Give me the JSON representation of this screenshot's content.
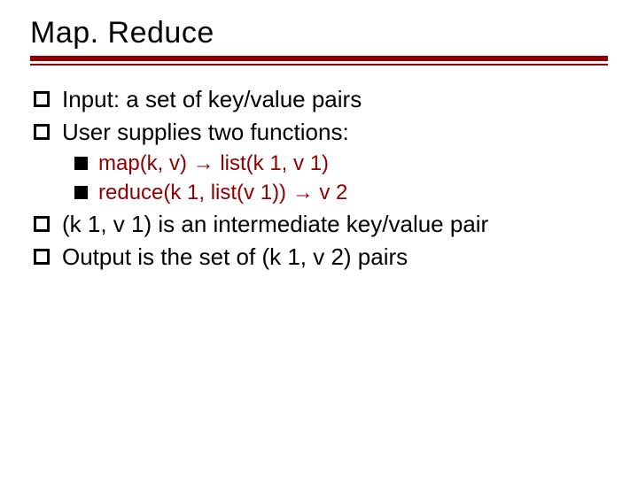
{
  "title": "Map. Reduce",
  "bullets": [
    {
      "level": 1,
      "text": "Input: a set of key/value pairs"
    },
    {
      "level": 1,
      "text": "User supplies two functions:"
    },
    {
      "level": 2,
      "text": "map(k, v) → list(k 1, v 1)"
    },
    {
      "level": 2,
      "text": "reduce(k 1, list(v 1)) → v 2"
    },
    {
      "level": 1,
      "text": "(k 1, v 1) is an intermediate key/value pair"
    },
    {
      "level": 1,
      "text": "Output is the set of (k 1, v 2) pairs"
    }
  ]
}
